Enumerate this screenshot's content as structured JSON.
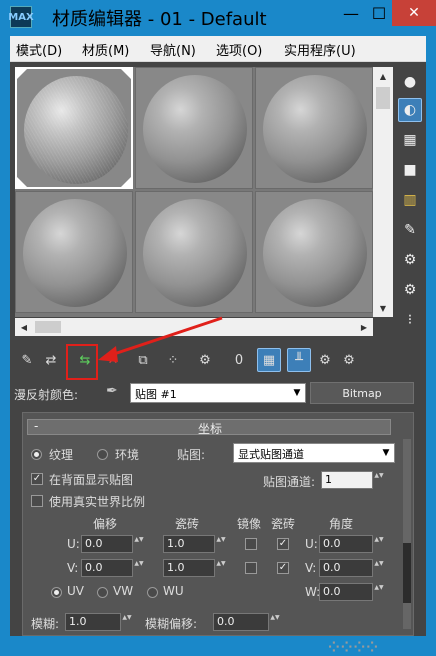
{
  "window": {
    "title": "材质编辑器 - 01 - Default",
    "app_icon_text": "MAX",
    "min_glyph": "—",
    "max_glyph": "☐",
    "close_glyph": "✕"
  },
  "menu": [
    "模式(D)",
    "材质(M)",
    "导航(N)",
    "选项(O)",
    "实用程序(U)"
  ],
  "slots": {
    "rows": 2,
    "cols": 3,
    "selected_index": 0
  },
  "scroll": {
    "up": "▲",
    "down": "▼",
    "left": "◀",
    "right": "▶"
  },
  "side_tools": [
    {
      "name": "sample-type-icon",
      "glyph": "●"
    },
    {
      "name": "backlight-icon",
      "glyph": "◐",
      "active": true
    },
    {
      "name": "background-icon",
      "glyph": "▦"
    },
    {
      "name": "uv-tiling-icon",
      "glyph": "■"
    },
    {
      "name": "video-color-check-icon",
      "glyph": "▥"
    },
    {
      "name": "make-preview-icon",
      "glyph": "✎"
    },
    {
      "name": "options-icon",
      "glyph": "⚙"
    },
    {
      "name": "select-by-material-icon",
      "glyph": "⚙"
    },
    {
      "name": "material-navigator-icon",
      "glyph": "⁝"
    }
  ],
  "toolbar": [
    {
      "name": "get-material-icon",
      "glyph": "✎"
    },
    {
      "name": "put-to-scene-icon",
      "glyph": "⇄"
    },
    {
      "name": "assign-to-selection-icon",
      "glyph": "⇆",
      "highlighted": true
    },
    {
      "name": "reset-map-icon",
      "glyph": "✕"
    },
    {
      "name": "copy-material-icon",
      "glyph": "⧉"
    },
    {
      "name": "make-unique-icon",
      "glyph": "⁘"
    },
    {
      "name": "put-to-library-icon",
      "glyph": "⚙"
    },
    {
      "name": "material-id-icon",
      "glyph": "0"
    },
    {
      "name": "show-map-in-viewport-icon",
      "glyph": "▦",
      "active": true
    },
    {
      "name": "show-end-result-icon",
      "glyph": "╨",
      "active": true
    },
    {
      "name": "go-to-parent-icon",
      "glyph": "⚙"
    },
    {
      "name": "go-forward-icon",
      "glyph": "⚙"
    }
  ],
  "material_row": {
    "label": "漫反射颜色:",
    "eyedropper_glyph": "✒",
    "map_name": "贴图 #1",
    "type_button": "Bitmap"
  },
  "coords": {
    "rollout_title": "坐标",
    "minus": "-",
    "texture_label": "纹理",
    "environ_label": "环境",
    "mapping_label": "贴图:",
    "mapping_value": "显式贴图通道",
    "show_on_back": "在背面显示贴图",
    "map_channel_label": "贴图通道:",
    "map_channel_value": "1",
    "real_world": "使用真实世界比例",
    "col_offset": "偏移",
    "col_tiling": "瓷砖",
    "col_mirror": "镜像",
    "col_tile": "瓷砖",
    "col_angle": "角度",
    "u_label": "U:",
    "v_label": "V:",
    "w_label": "W:",
    "u_offset": "0.0",
    "v_offset": "0.0",
    "u_tiling": "1.0",
    "v_tiling": "1.0",
    "u_angle": "0.0",
    "v_angle": "0.0",
    "w_angle": "0.0",
    "uv": "UV",
    "vw": "VW",
    "wu": "WU",
    "blur_label": "模糊:",
    "blur_value": "1.0",
    "blur_offset_label": "模糊偏移:",
    "blur_offset_value": "0.0",
    "check": "✓",
    "spin_glyph": "▲▼"
  },
  "watermark": "⁘⁘⁘⁘"
}
